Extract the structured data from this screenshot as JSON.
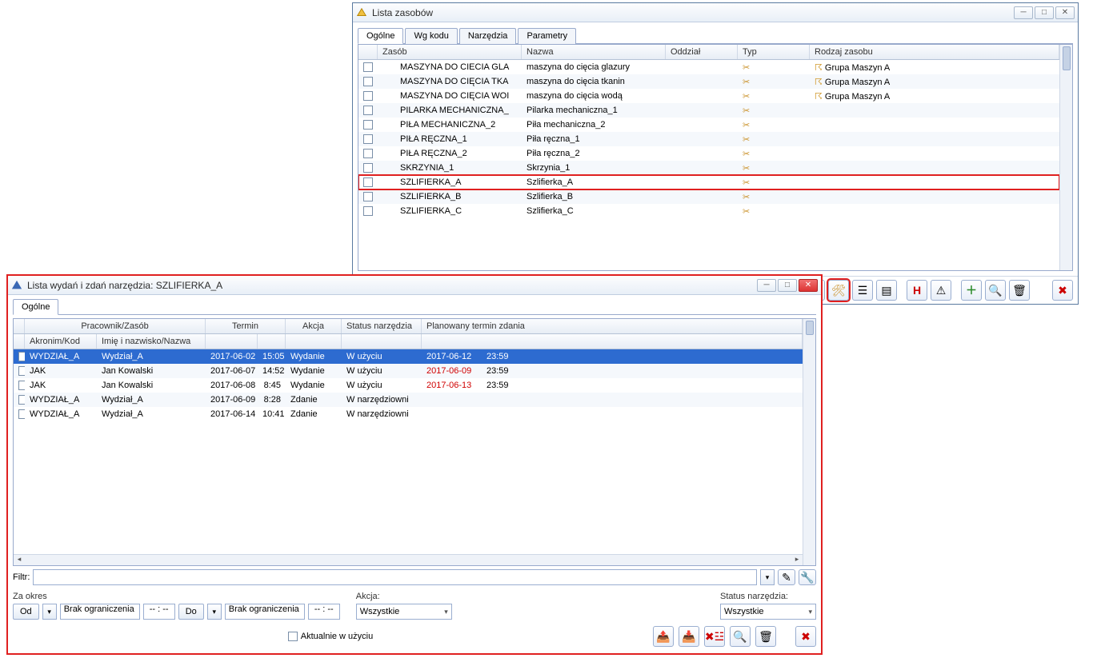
{
  "resourcesWindow": {
    "title": "Lista zasobów",
    "tabs": [
      "Ogólne",
      "Wg kodu",
      "Narzędzia",
      "Parametry"
    ],
    "columns": {
      "zasob": "Zasób",
      "nazwa": "Nazwa",
      "oddzial": "Oddział",
      "typ": "Typ",
      "rodzaj": "Rodzaj zasobu"
    },
    "rows": [
      {
        "zasob": "MASZYNA DO CIECIA GLA",
        "nazwa": "maszyna do cięcia glazury",
        "rodzaj": "Grupa Maszyn A"
      },
      {
        "zasob": "MASZYNA DO CIĘCIA TKA",
        "nazwa": "maszyna do cięcia tkanin",
        "rodzaj": "Grupa Maszyn A"
      },
      {
        "zasob": "MASZYNA DO CIĘCIA WOI",
        "nazwa": "maszyna do cięcia wodą",
        "rodzaj": "Grupa Maszyn A"
      },
      {
        "zasob": "PILARKA MECHANICZNA_",
        "nazwa": "Pilarka mechaniczna_1",
        "rodzaj": ""
      },
      {
        "zasob": "PIŁA MECHANICZNA_2",
        "nazwa": "Piła mechaniczna_2",
        "rodzaj": ""
      },
      {
        "zasob": "PIŁA RĘCZNA_1",
        "nazwa": "Piła ręczna_1",
        "rodzaj": ""
      },
      {
        "zasob": "PIŁA RĘCZNA_2",
        "nazwa": "Piła ręczna_2",
        "rodzaj": ""
      },
      {
        "zasob": "SKRZYNIA_1",
        "nazwa": "Skrzynia_1",
        "rodzaj": ""
      },
      {
        "zasob": "SZLIFIERKA_A",
        "nazwa": "Szlifierka_A",
        "rodzaj": "",
        "highlight": true
      },
      {
        "zasob": "SZLIFIERKA_B",
        "nazwa": "Szlifierka_B",
        "rodzaj": ""
      },
      {
        "zasob": "SZLIFIERKA_C",
        "nazwa": "Szlifierka_C",
        "rodzaj": ""
      }
    ]
  },
  "detailWindow": {
    "title": "Lista wydań i zdań narzędzia: SZLIFIERKA_A",
    "tab": "Ogólne",
    "colGroups": {
      "prac": "Pracownik/Zasób"
    },
    "columns": {
      "akr": "Akronim/Kod",
      "imie": "Imię i nazwisko/Nazwa",
      "termin": "Termin",
      "akcja": "Akcja",
      "status": "Status narzędzia",
      "plan": "Planowany termin zdania"
    },
    "rows": [
      {
        "akr": "WYDZIAŁ_A",
        "imie": "Wydział_A",
        "date": "2017-06-02",
        "time": "15:05",
        "akcja": "Wydanie",
        "status": "W użyciu",
        "pdate": "2017-06-12",
        "ptime": "23:59",
        "selected": true
      },
      {
        "akr": "JAK",
        "imie": "Jan Kowalski",
        "date": "2017-06-07",
        "time": "14:52",
        "akcja": "Wydanie",
        "status": "W użyciu",
        "pdate": "2017-06-09",
        "ptime": "23:59",
        "overdue": true
      },
      {
        "akr": "JAK",
        "imie": "Jan Kowalski",
        "date": "2017-06-08",
        "time": "8:45",
        "akcja": "Wydanie",
        "status": "W użyciu",
        "pdate": "2017-06-13",
        "ptime": "23:59",
        "overdue": true
      },
      {
        "akr": "WYDZIAŁ_A",
        "imie": "Wydział_A",
        "date": "2017-06-09",
        "time": "8:28",
        "akcja": "Zdanie",
        "status": "W narzędziowni",
        "pdate": "",
        "ptime": ""
      },
      {
        "akr": "WYDZIAŁ_A",
        "imie": "Wydział_A",
        "date": "2017-06-14",
        "time": "10:41",
        "akcja": "Zdanie",
        "status": "W narzędziowni",
        "pdate": "",
        "ptime": ""
      }
    ],
    "filterLabel": "Filtr:",
    "period": {
      "label": "Za okres",
      "odBtn": "Od",
      "doBtn": "Do",
      "noLimit": "Brak ograniczenia",
      "timePlaceholder": "-- : --"
    },
    "akcja": {
      "label": "Akcja:",
      "value": "Wszystkie"
    },
    "statusN": {
      "label": "Status narzędzia:",
      "value": "Wszystkie"
    },
    "inUse": "Aktualnie w użyciu"
  }
}
